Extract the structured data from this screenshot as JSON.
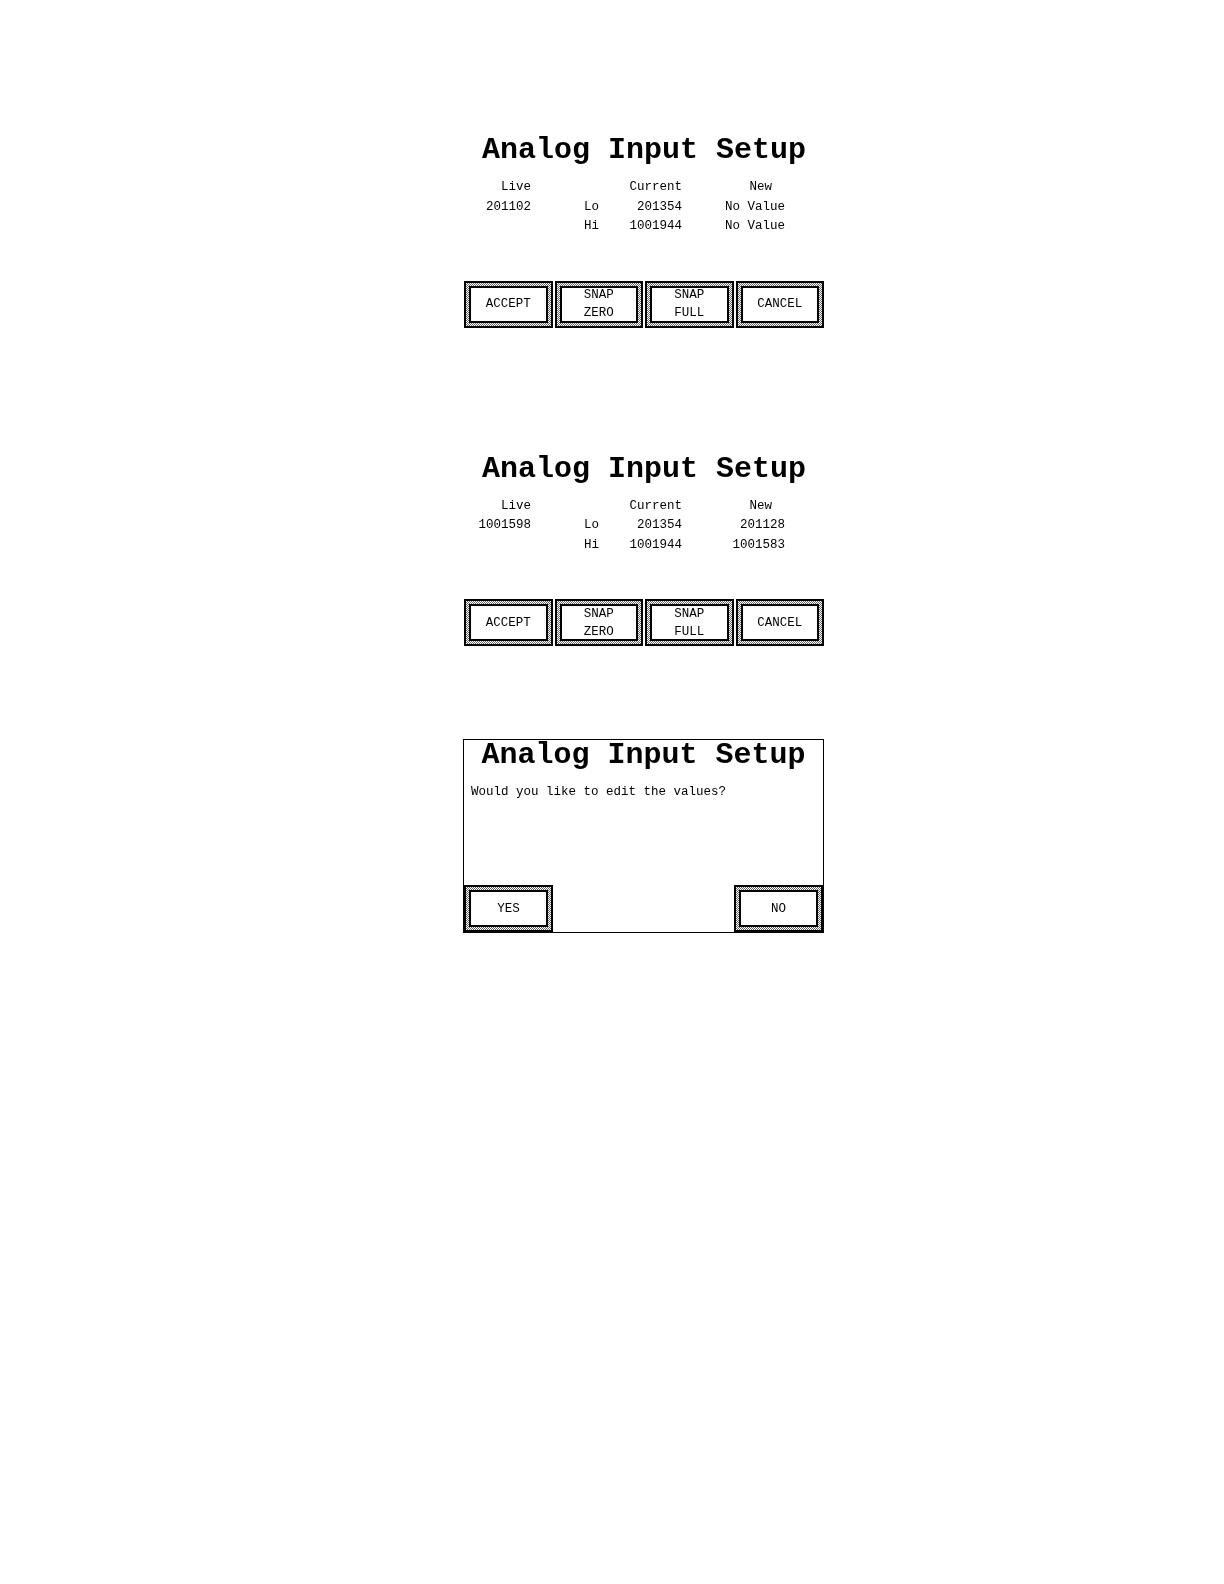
{
  "screens": [
    {
      "kind": "table",
      "title": "Analog Input Setup",
      "columns": {
        "live": "Live",
        "current": "Current",
        "new": "New"
      },
      "rows": [
        {
          "live": "201102",
          "label": "Lo",
          "current": "201354",
          "new": "No Value"
        },
        {
          "label": "Hi",
          "current": "1001944",
          "new": "No Value"
        }
      ],
      "buttons": [
        {
          "lines": [
            "ACCEPT"
          ]
        },
        {
          "lines": [
            "SNAP",
            "ZERO"
          ]
        },
        {
          "lines": [
            "SNAP",
            "FULL"
          ]
        },
        {
          "lines": [
            "CANCEL"
          ]
        }
      ]
    },
    {
      "kind": "table",
      "title": "Analog Input Setup",
      "columns": {
        "live": "Live",
        "current": "Current",
        "new": "New"
      },
      "rows": [
        {
          "live": "1001598",
          "label": "Lo",
          "current": "201354",
          "new": "201128"
        },
        {
          "label": "Hi",
          "current": "1001944",
          "new": "1001583"
        }
      ],
      "buttons": [
        {
          "lines": [
            "ACCEPT"
          ]
        },
        {
          "lines": [
            "SNAP",
            "ZERO"
          ]
        },
        {
          "lines": [
            "SNAP",
            "FULL"
          ]
        },
        {
          "lines": [
            "CANCEL"
          ]
        }
      ]
    },
    {
      "kind": "dialog",
      "title": "Analog Input Setup",
      "message": "Would you like to edit the values?",
      "buttons": [
        {
          "lines": [
            "YES"
          ]
        },
        {
          "lines": [
            "NO"
          ]
        }
      ]
    }
  ]
}
